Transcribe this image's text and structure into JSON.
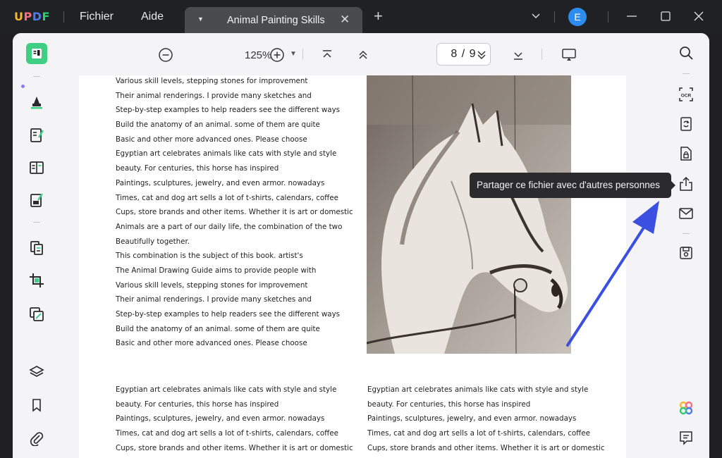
{
  "titlebar": {
    "logo": {
      "u": "U",
      "p": "P",
      "d": "D",
      "f": "F"
    },
    "menu_file": "Fichier",
    "menu_help": "Aide",
    "tab_title": "Animal Painting Skills",
    "tab_close": "✕",
    "new_tab": "+",
    "user_initial": "E"
  },
  "toolbar": {
    "zoom": "125%",
    "current_page": "8",
    "total_pages": "9",
    "page_separator": "/"
  },
  "tooltip": {
    "text": "Partager ce fichier avec d'autres personnes"
  },
  "document": {
    "column1_top": [
      "Various skill levels, stepping stones for improvement",
      "Their animal renderings. I provide many sketches and",
      "Step-by-step examples to help readers see the different ways",
      "Build the anatomy of an animal. some of them are quite",
      "Basic and other more advanced ones. Please choose",
      "Egyptian art celebrates animals like cats with style and style",
      "beauty. For centuries, this horse has inspired",
      "Paintings, sculptures, jewelry, and even armor. nowadays",
      "Times, cat and dog art sells a lot of t-shirts, calendars, coffee",
      "Cups, store brands and other items. Whether it is art or domestic",
      "Animals are a part of our daily life, the combination of the two",
      "Beautifully together.",
      "This combination is the subject of this book. artist's",
      "The Animal Drawing Guide aims to provide people with",
      "Various skill levels, stepping stones for improvement",
      "Their animal renderings. I provide many sketches and",
      "Step-by-step examples to help readers see the different ways",
      "Build the anatomy of an animal. some of them are quite",
      "Basic and other more advanced ones. Please choose"
    ],
    "column1_bottom": [
      "Egyptian art celebrates animals like cats with style and style",
      "beauty. For centuries, this horse has inspired",
      "Paintings, sculptures, jewelry, and even armor. nowadays",
      "Times, cat and dog art sells a lot of t-shirts, calendars, coffee",
      "Cups, store brands and other items. Whether it is art or domestic"
    ],
    "column2_bottom": [
      "Egyptian art celebrates animals like cats with style and style",
      "beauty. For centuries, this horse has inspired",
      "Paintings, sculptures, jewelry, and even armor. nowadays",
      "Times, cat and dog art sells a lot of t-shirts, calendars, coffee",
      "Cups, store brands and other items. Whether it is art or domestic"
    ]
  },
  "colors": {
    "accent_green": "#3fcf84",
    "avatar_blue": "#2d8cf0",
    "arrow_blue": "#3b4fe0"
  },
  "icons": {
    "left_sidebar": [
      "reader-icon",
      "highlighter-icon",
      "edit-text-icon",
      "form-icon",
      "sign-icon",
      "organize-pages-icon",
      "crop-icon",
      "redact-icon",
      "layers-icon",
      "bookmark-icon",
      "attachment-icon"
    ],
    "right_sidebar": [
      "search-icon",
      "ocr-icon",
      "convert-icon",
      "protect-icon",
      "share-icon",
      "email-icon",
      "save-icon",
      "ai-assistant-icon",
      "comment-icon"
    ]
  }
}
